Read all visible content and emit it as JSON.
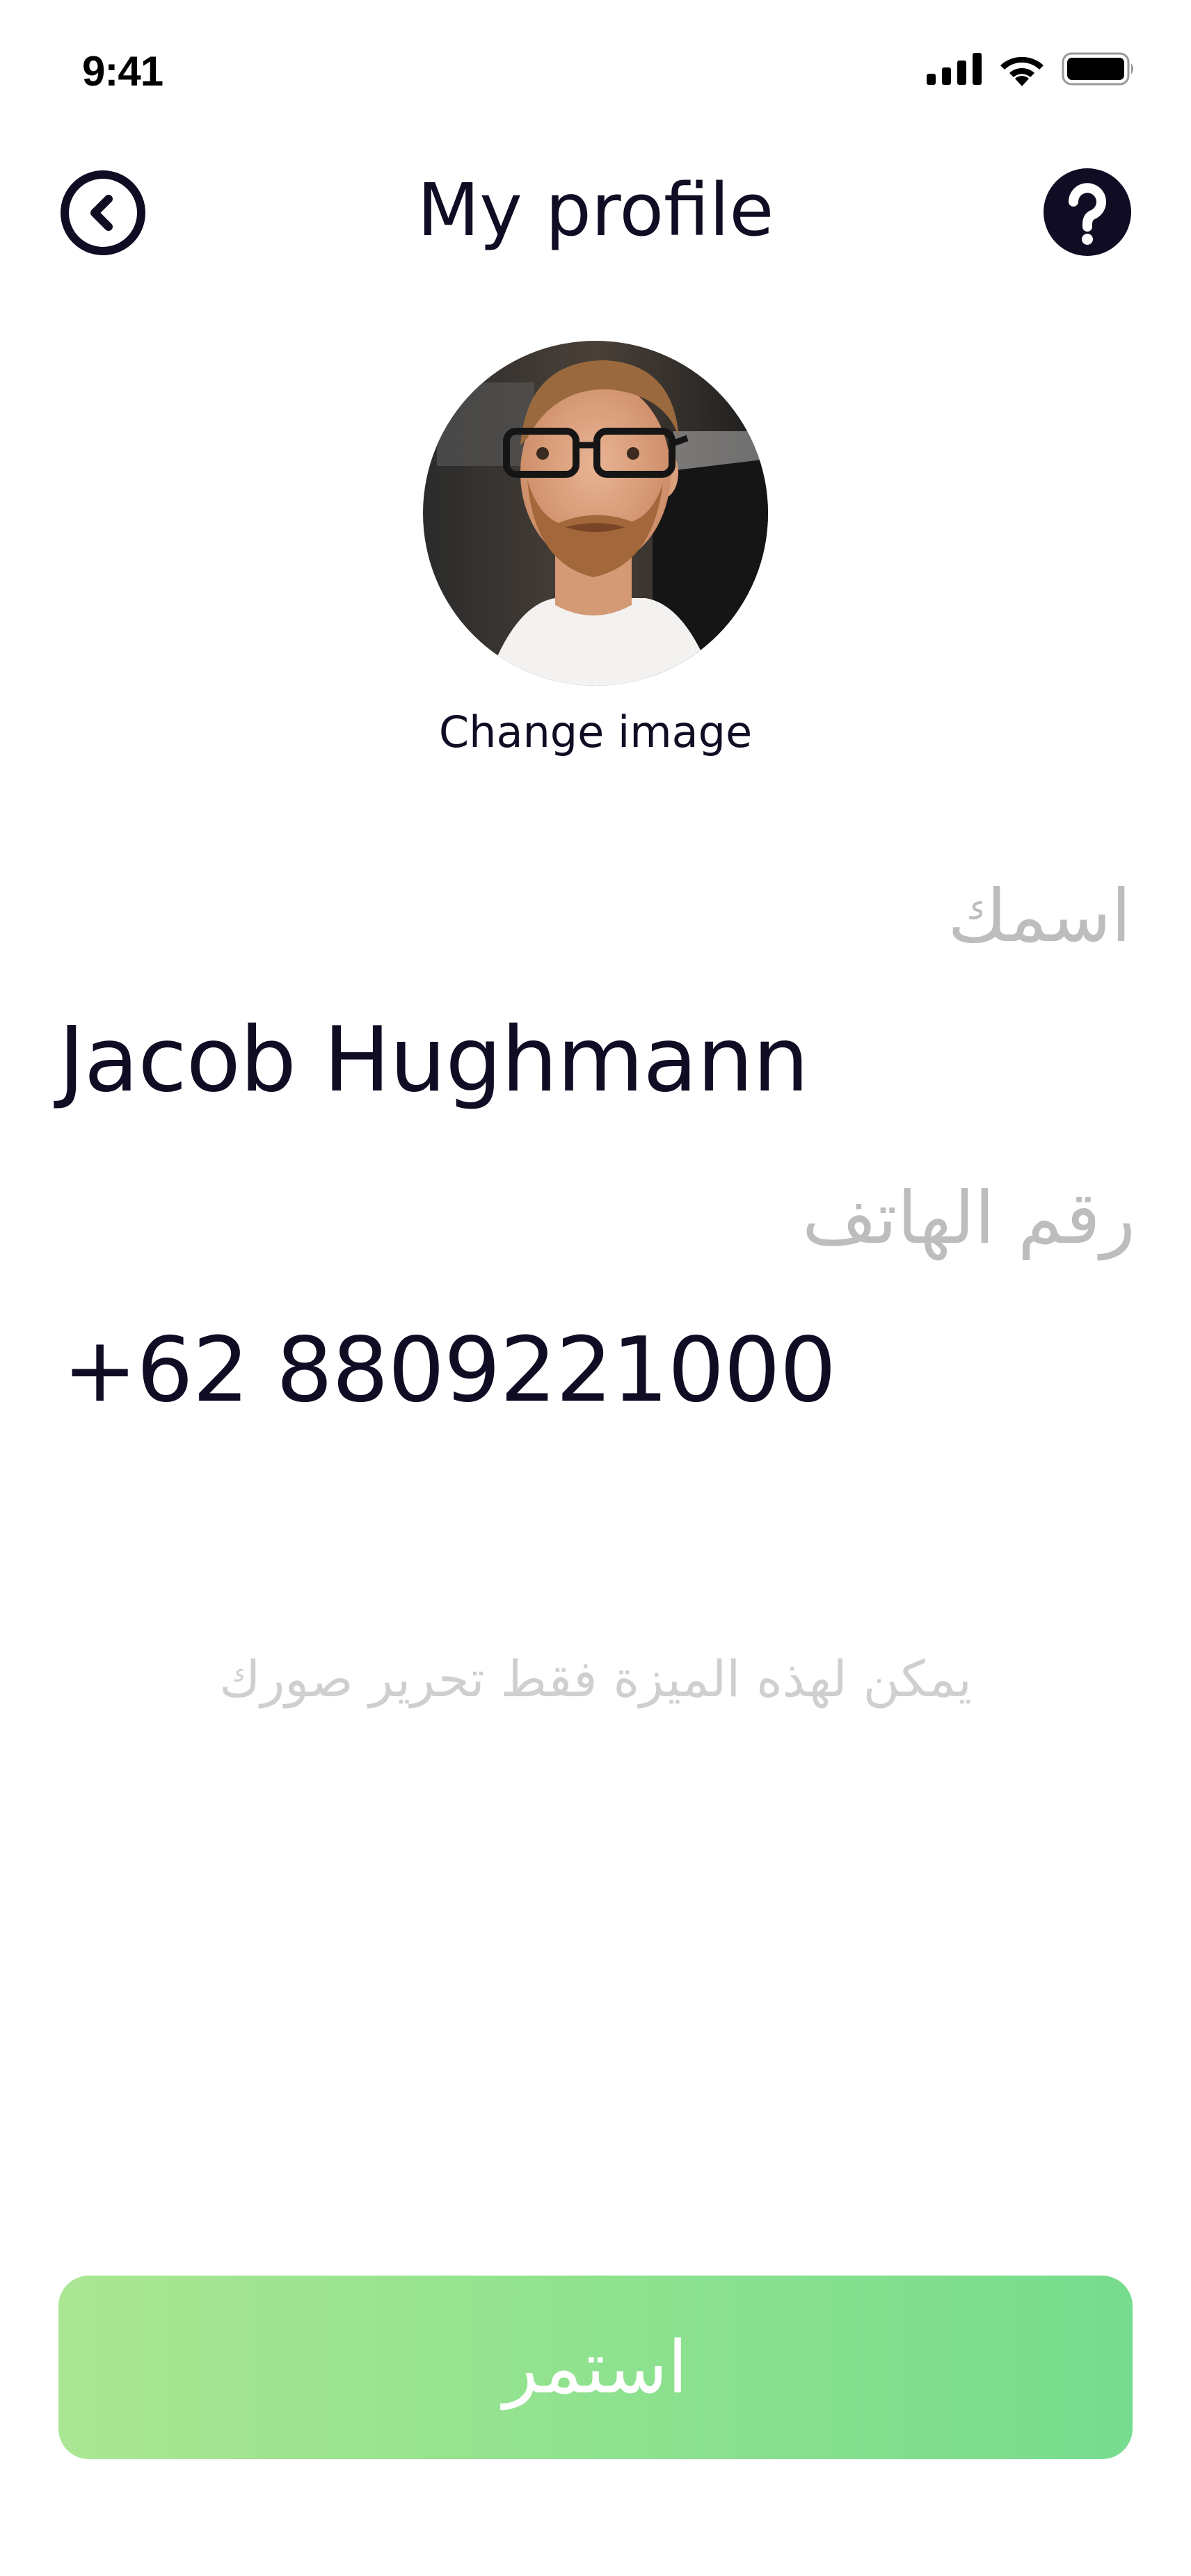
{
  "status_bar": {
    "time": "9:41",
    "icons": [
      "cellular-signal-icon",
      "wifi-icon",
      "battery-icon"
    ]
  },
  "header": {
    "title": "My profile",
    "back_icon": "chevron-left-circle-icon",
    "help_icon": "question-circle-icon"
  },
  "profile": {
    "change_image_label": "Change image"
  },
  "fields": {
    "name_label": "اسمك",
    "name_value": "Jacob Hughmann",
    "phone_label": "رقم الهاتف",
    "phone_value": "+62 8809221000"
  },
  "hint": "يمكن لهذه الميزة فقط تحرير صورك",
  "continue_button": {
    "label": "استمر"
  },
  "colors": {
    "text_primary": "#0f0c24",
    "label_gray": "#bdbdbd",
    "hint_gray": "#cfcfcf",
    "button_gradient_start": "#abe693",
    "button_gradient_end": "#77dc8e"
  }
}
